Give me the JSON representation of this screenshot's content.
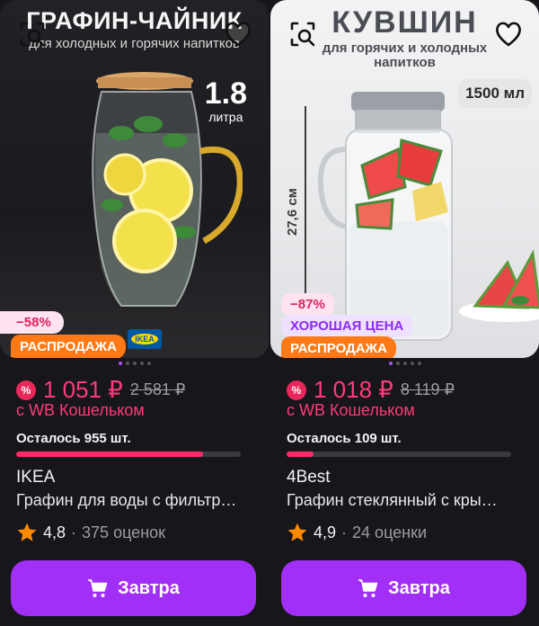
{
  "products": [
    {
      "photo": {
        "title": "ГРАФИН-ЧАЙНИК",
        "subtitle": "для холодных и горячих напитков",
        "volume_value": "1.8",
        "volume_unit": "литра",
        "brand_logo_text": "IKEA"
      },
      "discount_tag": "−58%",
      "promo_tag": "РАСПРОДАЖА",
      "price": "1 051 ₽",
      "old_price": "2 581 ₽",
      "wallet_label": "с WB Кошельком",
      "stock_text": "Осталось 955 шт.",
      "stock_level": 0.83,
      "brand": "IKEA",
      "name": "Графин для воды с фильтр…",
      "rating": "4,8",
      "reviews": "375 оценок",
      "button_label": "Завтра"
    },
    {
      "photo": {
        "title": "КУВШИН",
        "subtitle": "для горячих и холодных напитков",
        "volume_badge": "1500 мл",
        "height_label": "27,6 см"
      },
      "discount_tag": "−87%",
      "good_price_tag": "ХОРОШАЯ ЦЕНА",
      "promo_tag": "РАСПРОДАЖА",
      "price": "1 018 ₽",
      "old_price": "8 119 ₽",
      "wallet_label": "с WB Кошельком",
      "stock_text": "Осталось 109 шт.",
      "stock_level": 0.12,
      "brand": "4Best",
      "name": "Графин стеклянный с кры…",
      "rating": "4,9",
      "reviews": "24 оценки",
      "button_label": "Завтра"
    }
  ],
  "colors": {
    "accent": "#a22ff6",
    "price": "#ff3a7a",
    "sale": "#ff7a16",
    "star": "#ff8a00"
  },
  "icons": [
    "visual-search-icon",
    "heart-icon",
    "star-icon",
    "cart-icon",
    "percent-icon"
  ]
}
